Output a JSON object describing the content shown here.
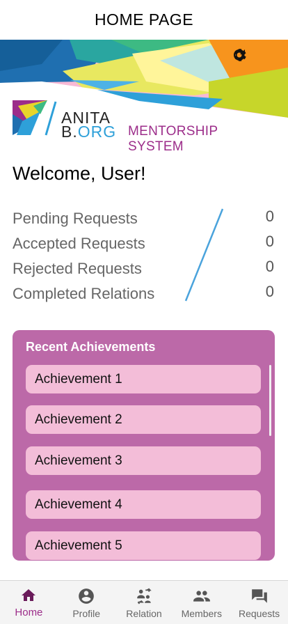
{
  "header": {
    "title": "HOME PAGE"
  },
  "banner": {
    "icons": [
      "gear-icon",
      "refresh-icon"
    ]
  },
  "logo": {
    "anita": "ANITA",
    "b": "B.",
    "org": "ORG",
    "system": "MENTORSHIP SYSTEM"
  },
  "welcome": "Welcome, User!",
  "stats": [
    {
      "label": "Pending Requests",
      "value": "0"
    },
    {
      "label": "Accepted Requests",
      "value": "0"
    },
    {
      "label": "Rejected Requests",
      "value": "0"
    },
    {
      "label": "Completed Relations",
      "value": "0"
    }
  ],
  "achievements": {
    "title": "Recent Achievements",
    "items": [
      "Achievement 1",
      "Achievement 2",
      "Achievement 3",
      "Achievement 4",
      "Achievement 5"
    ]
  },
  "nav": {
    "active": "Home",
    "items": [
      {
        "label": "Home",
        "icon": "home-icon"
      },
      {
        "label": "Profile",
        "icon": "profile-icon"
      },
      {
        "label": "Relation",
        "icon": "relation-icon"
      },
      {
        "label": "Members",
        "icon": "members-icon"
      },
      {
        "label": "Requests",
        "icon": "requests-icon"
      }
    ]
  },
  "colors": {
    "brand_purple": "#9c2d8a",
    "card_bg": "#bc69a8",
    "item_bg": "#f3bdd8",
    "org_blue": "#2ea0d9",
    "nav_active": "#6a1b5a"
  }
}
